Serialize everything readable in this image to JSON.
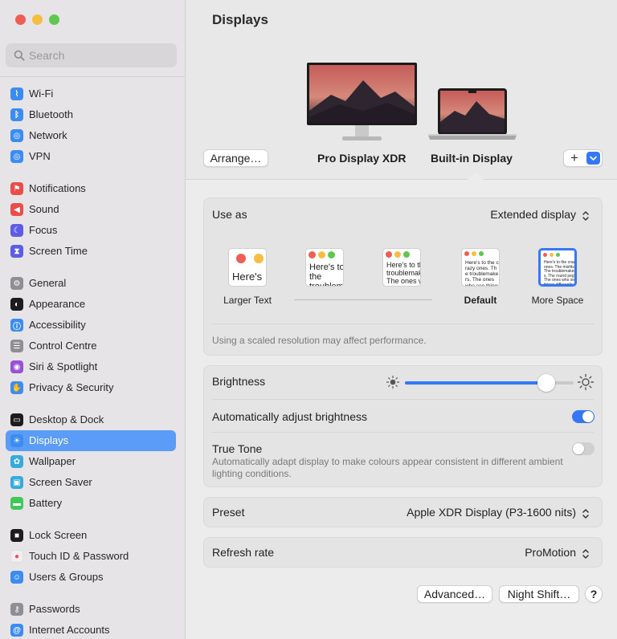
{
  "window": {
    "traffic_colors": [
      "#ee5e55",
      "#f6be41",
      "#5fc74f"
    ]
  },
  "sidebar": {
    "search_placeholder": "Search",
    "items": [
      {
        "label": "Wi-Fi",
        "icon": "wifi-icon",
        "color": "#3b8cf2"
      },
      {
        "label": "Bluetooth",
        "icon": "bluetooth-icon",
        "color": "#3b8cf2"
      },
      {
        "label": "Network",
        "icon": "globe-icon",
        "color": "#3b8cf2"
      },
      {
        "label": "VPN",
        "icon": "vpn-globe-icon",
        "color": "#3b8cf2"
      },
      {
        "label": "Notifications",
        "icon": "bell-icon",
        "color": "#ea4d48"
      },
      {
        "label": "Sound",
        "icon": "speaker-icon",
        "color": "#ea4d48"
      },
      {
        "label": "Focus",
        "icon": "moon-icon",
        "color": "#5e5ce6"
      },
      {
        "label": "Screen Time",
        "icon": "hourglass-icon",
        "color": "#5e5ce6"
      },
      {
        "label": "General",
        "icon": "gear-icon",
        "color": "#8e8e93"
      },
      {
        "label": "Appearance",
        "icon": "appearance-icon",
        "color": "#1c1c1e"
      },
      {
        "label": "Accessibility",
        "icon": "accessibility-icon",
        "color": "#3b8cf2"
      },
      {
        "label": "Control Centre",
        "icon": "control-centre-icon",
        "color": "#8e8e93"
      },
      {
        "label": "Siri & Spotlight",
        "icon": "siri-icon",
        "color": "#9b4fd6"
      },
      {
        "label": "Privacy & Security",
        "icon": "hand-icon",
        "color": "#3b8cf2"
      },
      {
        "label": "Desktop & Dock",
        "icon": "dock-icon",
        "color": "#1c1c1e"
      },
      {
        "label": "Displays",
        "icon": "sun-icon",
        "color": "#3b8cf2"
      },
      {
        "label": "Wallpaper",
        "icon": "flower-icon",
        "color": "#36aadc"
      },
      {
        "label": "Screen Saver",
        "icon": "screensaver-icon",
        "color": "#36aadc"
      },
      {
        "label": "Battery",
        "icon": "battery-icon",
        "color": "#42c759"
      },
      {
        "label": "Lock Screen",
        "icon": "lock-icon",
        "color": "#1c1c1e"
      },
      {
        "label": "Touch ID & Password",
        "icon": "fingerprint-icon",
        "color": "#f0efef"
      },
      {
        "label": "Users & Groups",
        "icon": "users-icon",
        "color": "#3b8cf2"
      },
      {
        "label": "Passwords",
        "icon": "key-icon",
        "color": "#8e8e93"
      },
      {
        "label": "Internet Accounts",
        "icon": "at-icon",
        "color": "#3b8cf2"
      }
    ]
  },
  "main": {
    "title": "Displays",
    "arrange_label": "Arrange…",
    "display_1_name": "Pro Display XDR",
    "display_2_name": "Built-in Display",
    "add_label": "+",
    "use_as_label": "Use as",
    "use_as_value": "Extended display",
    "resolutions": [
      {
        "label": "Larger Text",
        "sample": "Here's"
      },
      {
        "label": "",
        "sample": "Here's to the troublemakers."
      },
      {
        "label": "",
        "sample": "Here's to the troublemakers. The ones who see"
      },
      {
        "label": "Default",
        "sample": "Here's to the crazy ones. The troublemakers. The ones who see things differently. They're not fond of rules. And they"
      },
      {
        "label": "More Space",
        "sample": "Here's to the crazy ones. The misfits. The troublemakers. The round pegs. The ones who see things differently. They're not fond of rules. And they have no respect. You can quote them, disagree with them. About the only thing. Because they change things."
      }
    ],
    "scaled_note": "Using a scaled resolution may affect performance.",
    "brightness_label": "Brightness",
    "brightness_level": 0.88,
    "auto_brightness_label": "Automatically adjust brightness",
    "auto_brightness_on": true,
    "true_tone_label": "True Tone",
    "true_tone_on": false,
    "true_tone_desc": "Automatically adapt display to make colours appear consistent in different ambient lighting conditions.",
    "preset_label": "Preset",
    "preset_value": "Apple XDR Display (P3-1600 nits)",
    "refresh_label": "Refresh rate",
    "refresh_value": "ProMotion",
    "advanced_label": "Advanced…",
    "night_shift_label": "Night Shift…",
    "help_label": "?",
    "accent_color": "#3478f6"
  }
}
